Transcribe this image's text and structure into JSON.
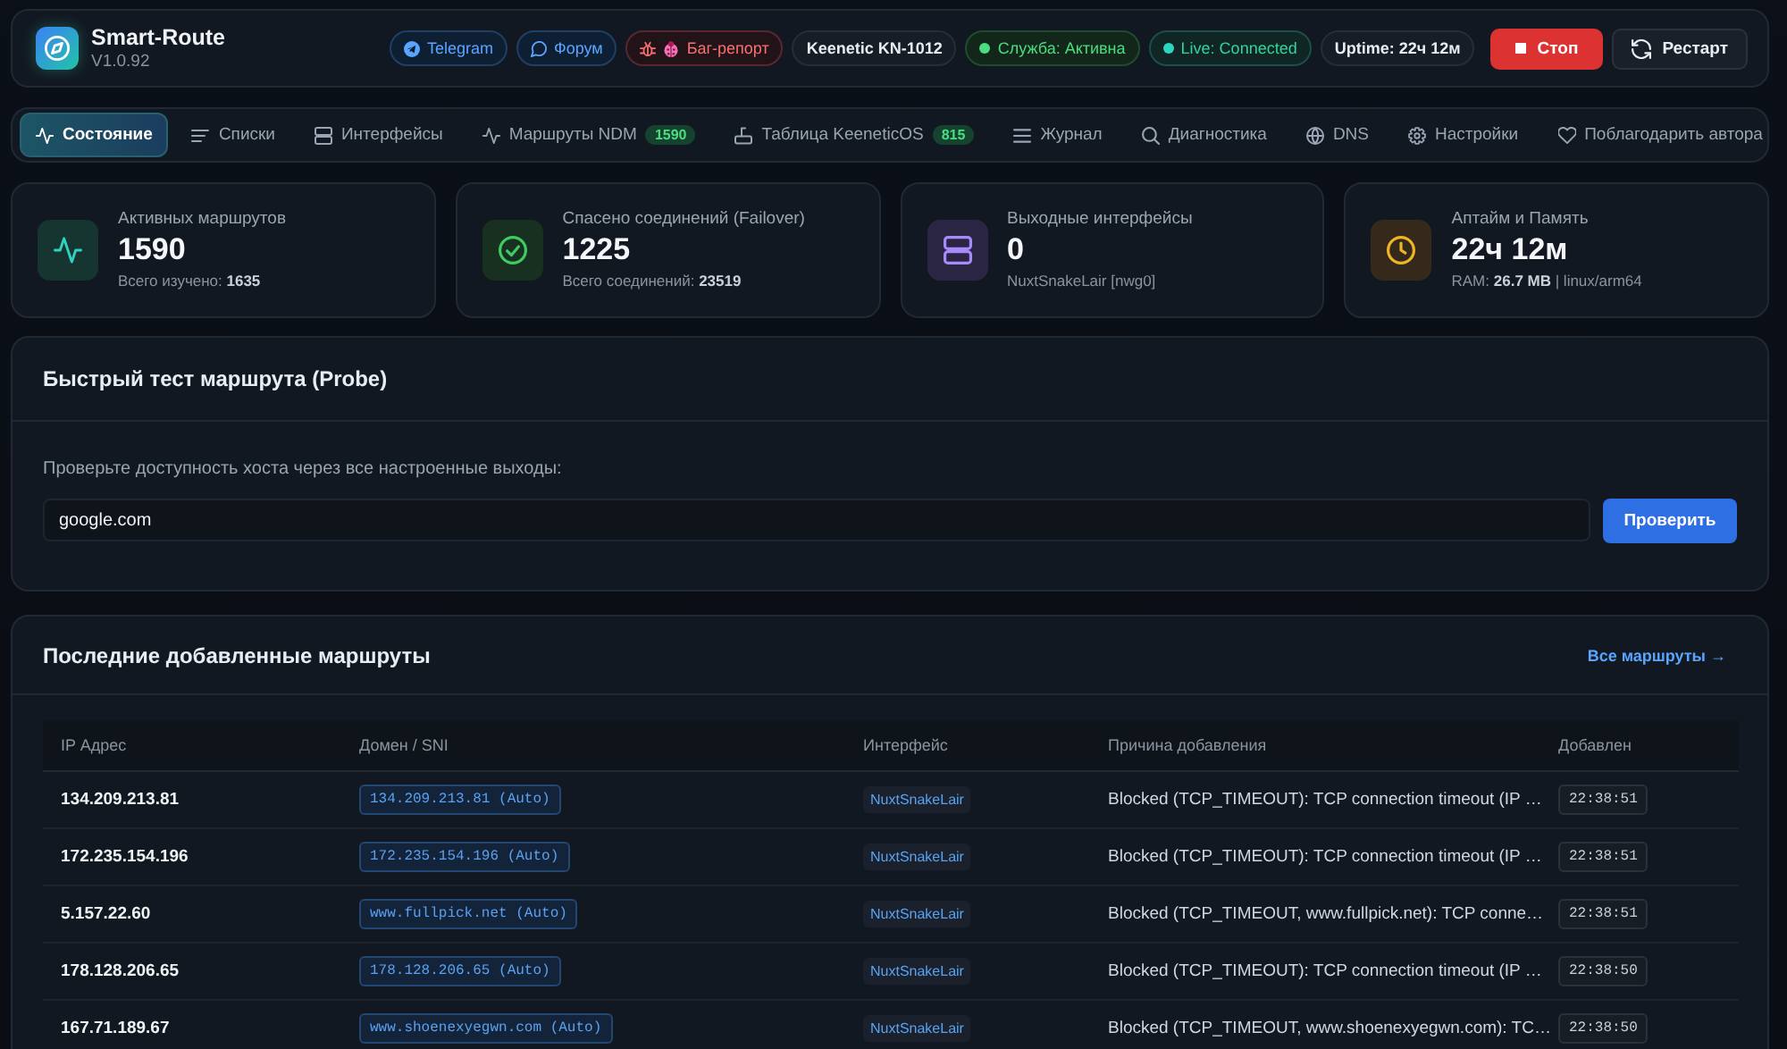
{
  "header": {
    "app_name": "Smart-Route",
    "version": "V1.0.92",
    "pills": [
      {
        "kind": "telegram",
        "label": "Telegram"
      },
      {
        "kind": "forum",
        "label": "Форум"
      },
      {
        "kind": "bugreport",
        "label": "Баг-репорт"
      },
      {
        "kind": "device",
        "label": "Keenetic KN-1012"
      },
      {
        "kind": "service",
        "label": "Служба: Активна"
      },
      {
        "kind": "live",
        "label": "Live: Connected"
      },
      {
        "kind": "uptime",
        "label": "Uptime: 22ч 12м"
      }
    ],
    "buttons": [
      {
        "kind": "stop",
        "label": "Стоп"
      },
      {
        "kind": "restart",
        "label": "Рестарт"
      }
    ]
  },
  "tabs": [
    {
      "label": "Состояние",
      "selected": true
    },
    {
      "label": "Списки",
      "selected": false
    },
    {
      "label": "Интерфейсы",
      "selected": false
    },
    {
      "label": "Маршруты NDM",
      "badge": "1590",
      "selected": false
    },
    {
      "label": "Таблица KeeneticOS",
      "badge": "815",
      "selected": false
    },
    {
      "label": "Журнал",
      "selected": false
    },
    {
      "label": "Диагностика",
      "selected": false
    },
    {
      "label": "DNS",
      "selected": false
    },
    {
      "label": "Настройки",
      "selected": false
    },
    {
      "label": "Поблагодарить автора",
      "selected": false
    }
  ],
  "stats": [
    {
      "label": "Активных маршрутов",
      "value": "1590",
      "detail": "Всего изучено: **1635**"
    },
    {
      "label": "Спасено соединений (Failover)",
      "value": "1225",
      "detail": "Всего соединений: **23519**"
    },
    {
      "label": "Выходные интерфейсы",
      "value": "0",
      "detail": "NuxtSnakeLair [nwg0]"
    },
    {
      "label": "Аптайм и Память",
      "value": "22ч 12м",
      "detail": "RAM: **26.7 MB** | linux/arm64"
    }
  ],
  "probe": {
    "title": "Быстрый тест маршрута (Probe)",
    "prompt": "Проверьте доступность хоста через все настроенные выходы:",
    "input": {
      "value": "google.com"
    },
    "button": "Проверить"
  },
  "recent_routes": {
    "title": "Последние добавленные маршруты",
    "link": "Все маршруты →",
    "table": {
      "columns": [
        "IP Адрес",
        "Домен / SNI",
        "Интерфейс",
        "Причина добавления",
        "Добавлен"
      ],
      "rows": [
        {
          "ip": "134.209.213.81",
          "domain": "134.209.213.81 (Auto)",
          "interface": "NuxtSnakeLair",
          "reason": "Blocked (TCP_TIMEOUT): TCP connection timeout (IP …",
          "added": "22:38:51"
        },
        {
          "ip": "172.235.154.196",
          "domain": "172.235.154.196 (Auto)",
          "interface": "NuxtSnakeLair",
          "reason": "Blocked (TCP_TIMEOUT): TCP connection timeout (IP …",
          "added": "22:38:51"
        },
        {
          "ip": "5.157.22.60",
          "domain": "www.fullpick.net (Auto)",
          "interface": "NuxtSnakeLair",
          "reason": "Blocked (TCP_TIMEOUT, www.fullpick.net): TCP conne…",
          "added": "22:38:51"
        },
        {
          "ip": "178.128.206.65",
          "domain": "178.128.206.65 (Auto)",
          "interface": "NuxtSnakeLair",
          "reason": "Blocked (TCP_TIMEOUT): TCP connection timeout (IP …",
          "added": "22:38:50"
        },
        {
          "ip": "167.71.189.67",
          "domain": "www.shoenexyegwn.com (Auto)",
          "interface": "NuxtSnakeLair",
          "reason": "Blocked (TCP_TIMEOUT, www.shoenexyegwn.com): TC…",
          "added": "22:38:50"
        }
      ]
    }
  }
}
